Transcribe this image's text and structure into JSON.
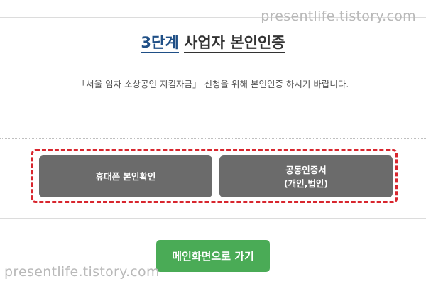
{
  "watermark": "presentlife.tistory.com",
  "header": {
    "step": "3단계",
    "title": "사업자 본인인증"
  },
  "description": "「서울 임차 소상공인 지킴자금」 신청을 위해 본인인증 하시기 바랍니다.",
  "auth_options": {
    "phone": "휴대폰 본인확인",
    "certificate_line1": "공동인증서",
    "certificate_line2": "(개인,법인)"
  },
  "main_button": "메인화면으로 가기",
  "colors": {
    "accent_blue": "#1f4f86",
    "highlight_red": "#d8262e",
    "button_gray": "#6b6b6b",
    "main_green": "#4aab56"
  }
}
